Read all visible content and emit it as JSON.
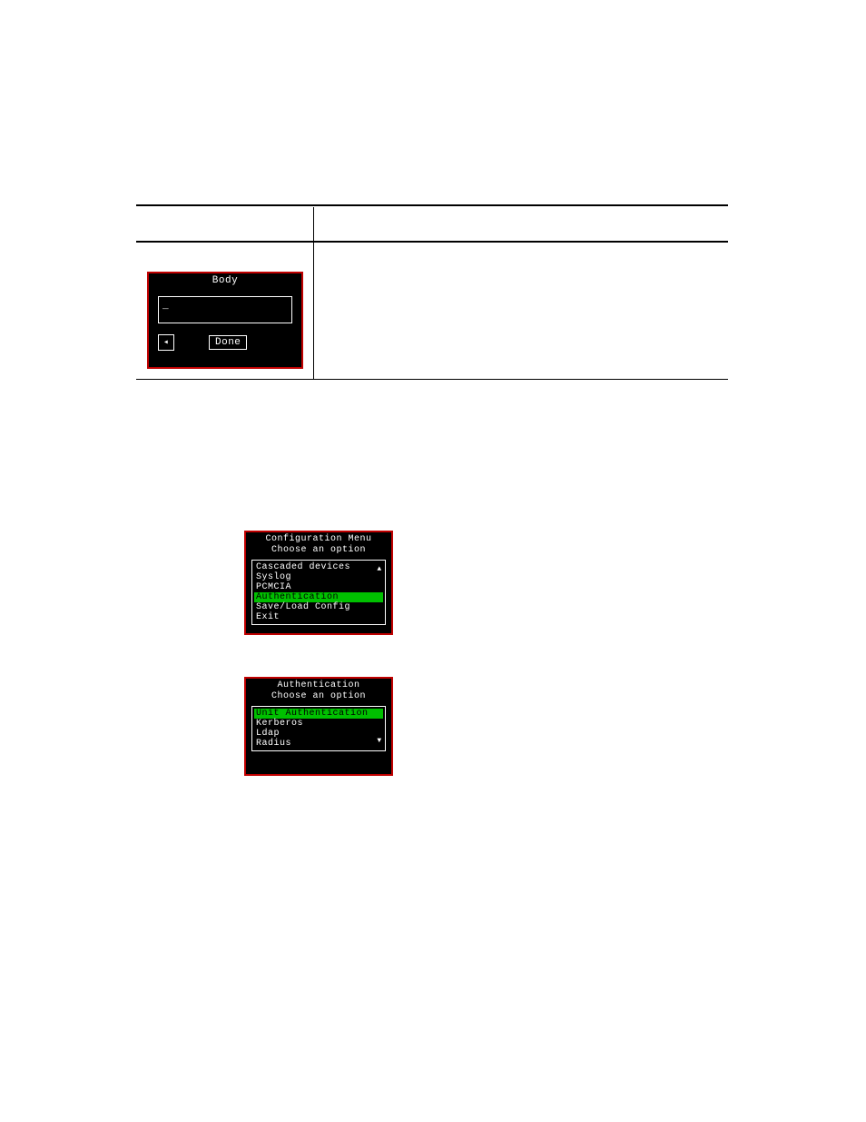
{
  "body_dialog": {
    "title": "Body",
    "input_value": "_",
    "back_glyph": "◂",
    "done_label": "Done"
  },
  "config_menu": {
    "title_line1": "Configuration Menu",
    "title_line2": "Choose an option",
    "items": [
      {
        "label": "Cascaded devices",
        "selected": false
      },
      {
        "label": "Syslog",
        "selected": false
      },
      {
        "label": "PCMCIA",
        "selected": false
      },
      {
        "label": "Authentication",
        "selected": true
      },
      {
        "label": "Save/Load Config",
        "selected": false
      },
      {
        "label": "Exit",
        "selected": false
      }
    ],
    "scroll_up_glyph": "▲"
  },
  "auth_menu": {
    "title_line1": "Authentication",
    "title_line2": "Choose an option",
    "items": [
      {
        "label": "Unit Authentication",
        "selected": true
      },
      {
        "label": "Kerberos",
        "selected": false
      },
      {
        "label": "Ldap",
        "selected": false
      },
      {
        "label": "Radius",
        "selected": false
      }
    ],
    "scroll_down_glyph": "▼"
  }
}
